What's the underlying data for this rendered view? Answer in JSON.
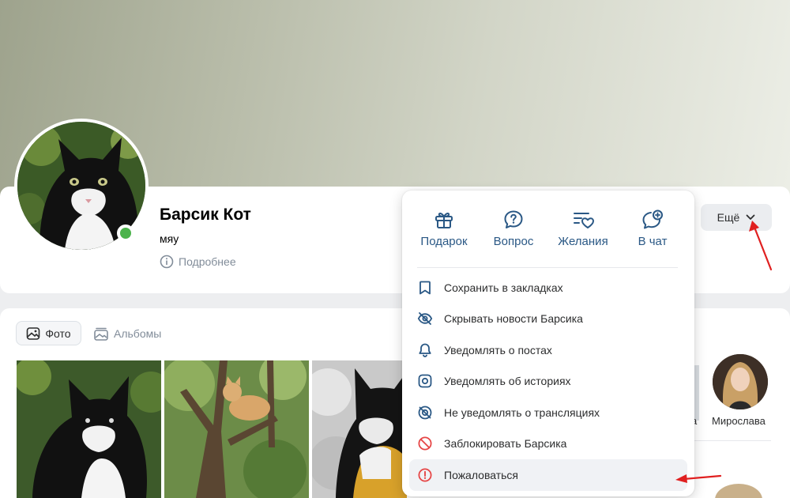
{
  "profile": {
    "name": "Барсик Кот",
    "status": "мяу",
    "more_info": "Подробнее",
    "more_button": "Ещё"
  },
  "tabs": [
    {
      "label": "Фото",
      "icon": "photo-icon",
      "active": true
    },
    {
      "label": "Альбомы",
      "icon": "albums-icon",
      "active": false
    }
  ],
  "friends": {
    "partial_name": "а",
    "name": "Мирослава"
  },
  "dropdown": {
    "quick_actions": [
      {
        "label": "Подарок",
        "icon": "gift-icon"
      },
      {
        "label": "Вопрос",
        "icon": "question-bubble-icon"
      },
      {
        "label": "Желания",
        "icon": "wishlist-icon"
      },
      {
        "label": "В чат",
        "icon": "add-to-chat-icon"
      }
    ],
    "menu": [
      {
        "label": "Сохранить в закладках",
        "icon": "bookmark-icon"
      },
      {
        "label": "Скрывать новости Барсика",
        "icon": "eye-crossed-icon"
      },
      {
        "label": "Уведомлять о постах",
        "icon": "bell-icon"
      },
      {
        "label": "Уведомлять об историях",
        "icon": "stories-icon"
      },
      {
        "label": "Не уведомлять о трансляциях",
        "icon": "broadcast-off-icon"
      },
      {
        "label": "Заблокировать Барсика",
        "icon": "block-icon",
        "color": "#e64646"
      },
      {
        "label": "Пожаловаться",
        "icon": "report-icon",
        "color": "#e64646",
        "highlighted": true
      }
    ]
  },
  "colors": {
    "accent": "#2a5885",
    "danger": "#e64646",
    "annotation_arrow": "#e02020",
    "online": "#4bb34b"
  }
}
